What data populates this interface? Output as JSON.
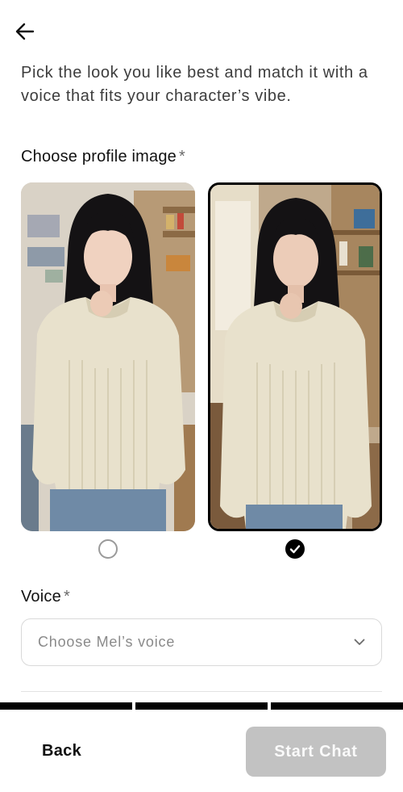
{
  "intro": {
    "text": "Pick the look you like best and match it with a voice that fits your character’s vibe."
  },
  "profile": {
    "label": "Choose profile image",
    "required_mark": "*",
    "options": [
      {
        "selected": false
      },
      {
        "selected": true
      }
    ]
  },
  "voice": {
    "label": "Voice",
    "required_mark": "*",
    "placeholder": "Choose Mel’s voice"
  },
  "progress": {
    "total_steps": 3,
    "completed_steps": 3
  },
  "footer": {
    "back_label": "Back",
    "start_label": "Start Chat",
    "start_enabled": false
  },
  "colors": {
    "accent": "#000000",
    "disabled_button": "#c2c2c2",
    "placeholder_text": "#8a8a8a",
    "sweater": "#e8e1cc",
    "hair": "#141214",
    "jeans": "#6f8aa6"
  },
  "icons": {
    "back": "arrow-left-icon",
    "dropdown": "chevron-down-icon",
    "selected_radio": "checkmark-icon"
  }
}
